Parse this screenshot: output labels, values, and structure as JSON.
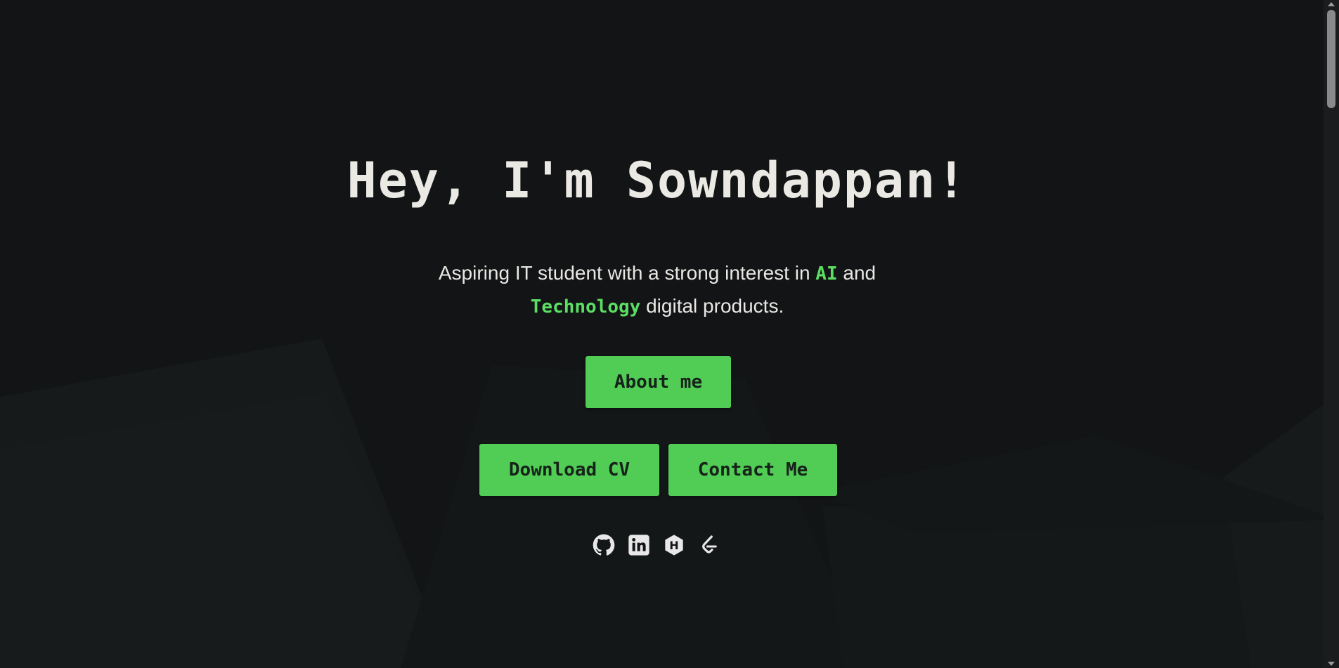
{
  "hero": {
    "title": "Hey, I'm Sowndappan!",
    "subtitle_part1": "Aspiring IT student with a strong interest in ",
    "highlight_ai": "AI",
    "subtitle_part2": " and",
    "highlight_tech": "Technology",
    "subtitle_part3": " digital products."
  },
  "buttons": {
    "about": "About me",
    "download_cv": "Download CV",
    "contact": "Contact Me"
  },
  "socials": [
    {
      "icon": "github-icon"
    },
    {
      "icon": "linkedin-icon"
    },
    {
      "icon": "hashnode-icon"
    },
    {
      "icon": "leetcode-icon"
    }
  ],
  "colors": {
    "background": "#121416",
    "accent_green": "#51cc55",
    "highlight_green": "#5cde63",
    "text_light": "#ebe9e4"
  }
}
